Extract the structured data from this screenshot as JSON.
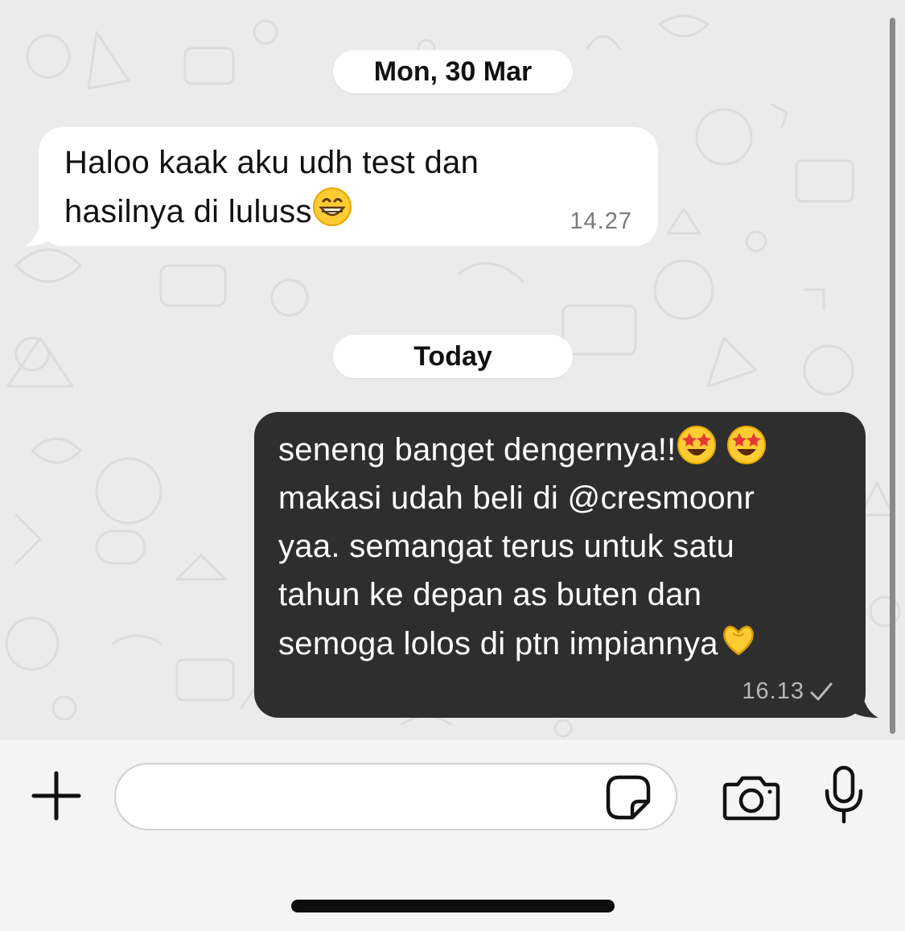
{
  "chat": {
    "dates": [
      "Mon, 30 Mar",
      "Today"
    ],
    "incoming": {
      "lines": [
        "Haloo kaak aku udh test dan",
        "hasilnya di luluss"
      ],
      "emoji": "grinning-face-with-smiling-eyes",
      "time": "14.27"
    },
    "outgoing": {
      "lines": [
        "seneng banget dengernya!!",
        "makasi udah beli di @cresmoonr",
        "yaa. semangat terus untuk satu",
        "tahun ke depan as buten dan",
        "semoga lolos di ptn impiannya"
      ],
      "emojis": [
        "star-struck",
        "star-struck",
        "heart-hands"
      ],
      "time": "16.13",
      "status_icon": "single-check-icon"
    }
  },
  "composer": {
    "placeholder": "",
    "icons": [
      "plus-icon",
      "sticker-icon",
      "camera-icon",
      "microphone-icon"
    ]
  },
  "colors": {
    "incoming_bubble": "#ffffff",
    "outgoing_bubble": "#2e2e2e",
    "wallpaper": "#ebebeb"
  }
}
